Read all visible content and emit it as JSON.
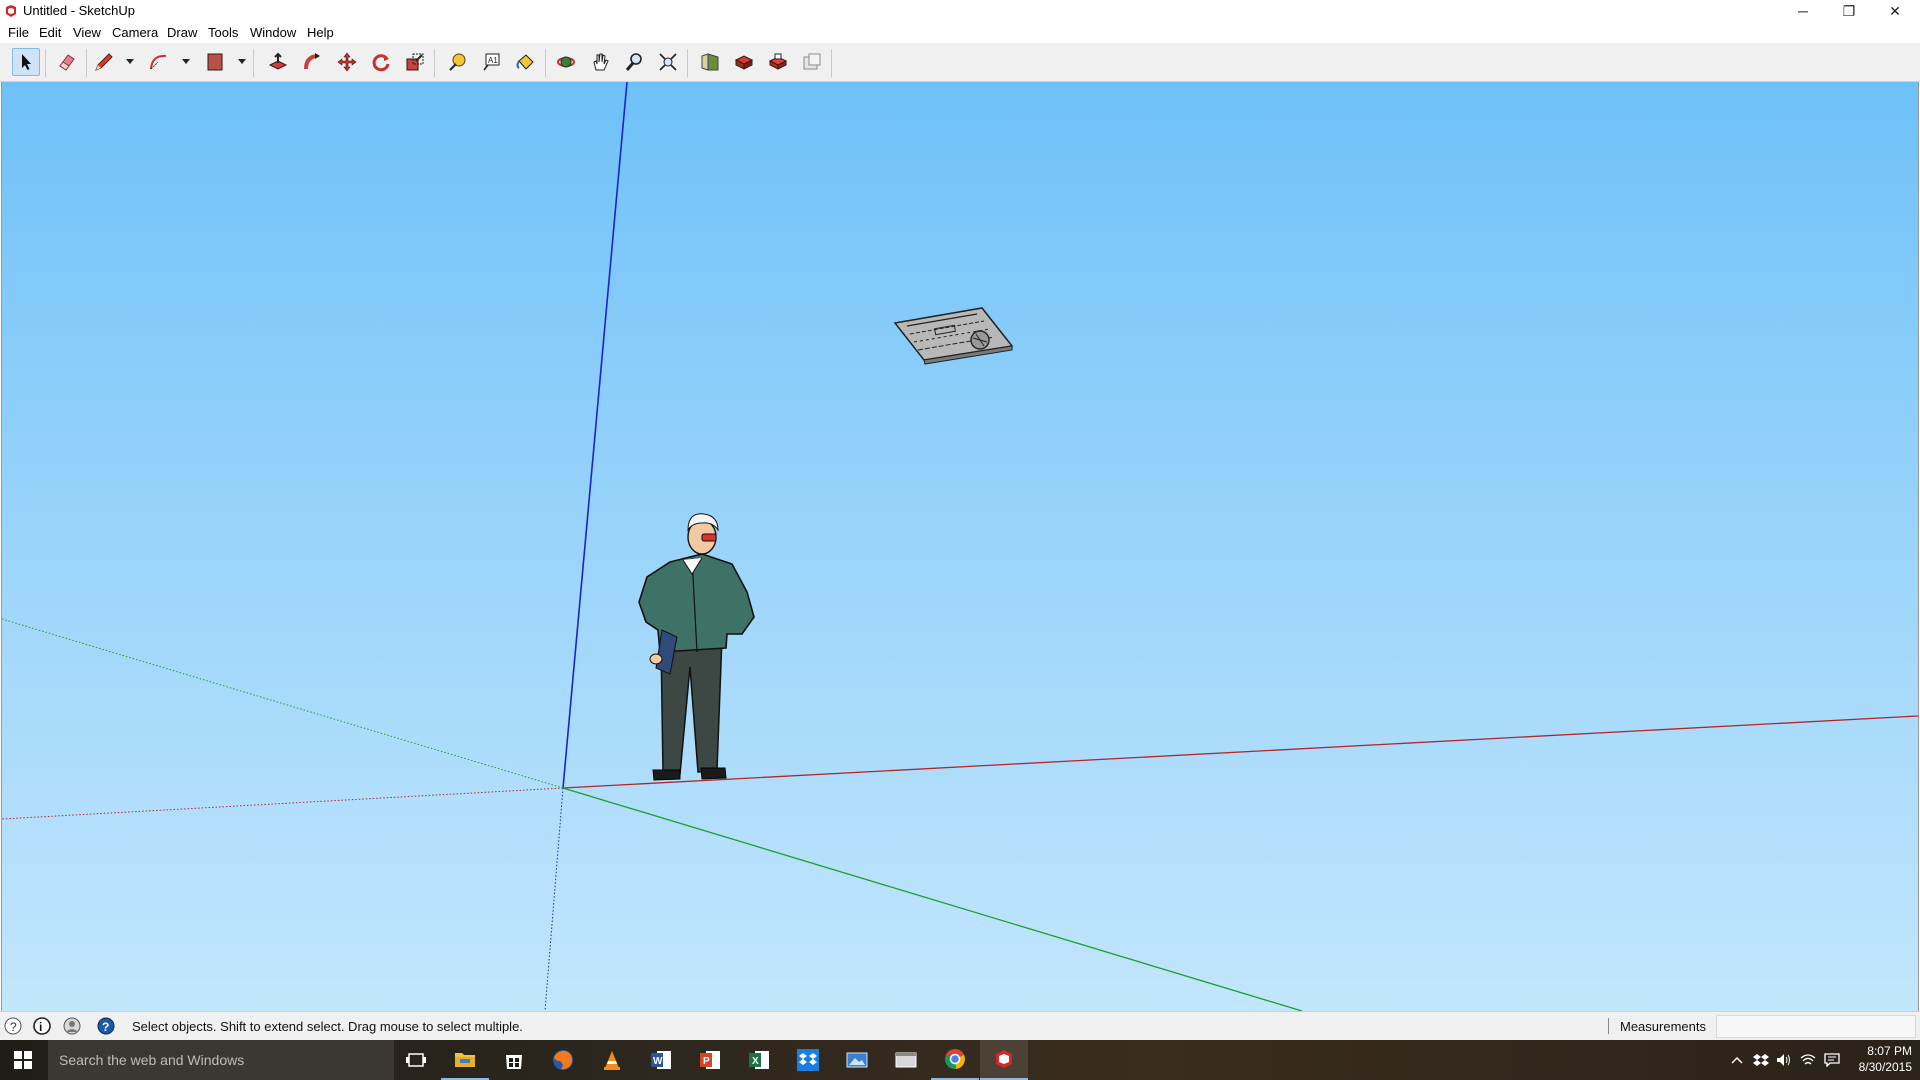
{
  "window": {
    "title": "Untitled - SketchUp",
    "controls": {
      "minimize": "─",
      "restore": "❐",
      "close": "✕"
    }
  },
  "menu": [
    "File",
    "Edit",
    "View",
    "Camera",
    "Draw",
    "Tools",
    "Window",
    "Help"
  ],
  "toolbar": {
    "tools": [
      "select-icon",
      "eraser-icon",
      "pencil-line-icon",
      "arc-icon",
      "rectangle-icon",
      "push-pull-icon",
      "follow-me-icon",
      "move-icon",
      "rotate-icon",
      "scale-icon",
      "tape-measure-icon",
      "text-icon",
      "paint-bucket-icon",
      "orbit-icon",
      "pan-icon",
      "zoom-icon",
      "zoom-extents-icon",
      "3d-warehouse-icon",
      "extension-warehouse-icon",
      "layout-icon",
      "extension-manager-icon"
    ],
    "selected_tool": "select-icon"
  },
  "scene": {
    "axis_colors": {
      "red": "#b3262a",
      "green": "#1f9e2b",
      "blue": "#1a24c8"
    },
    "objects": [
      "figure-person",
      "floating-keyboard-component"
    ]
  },
  "statusbar": {
    "message": "Select objects. Shift to extend select. Drag mouse to select multiple.",
    "measurements_label": "Measurements",
    "measurements_value": ""
  },
  "taskbar": {
    "search_placeholder": "Search the web and Windows",
    "time": "8:07 PM",
    "date": "8/30/2015",
    "apps": [
      "task-view-icon",
      "file-explorer-icon",
      "store-icon",
      "firefox-icon",
      "vlc-icon",
      "word-icon",
      "powerpoint-icon",
      "excel-icon",
      "dropbox-icon",
      "photos-icon",
      "explorer-window-icon",
      "chrome-icon",
      "sketchup-icon"
    ]
  }
}
